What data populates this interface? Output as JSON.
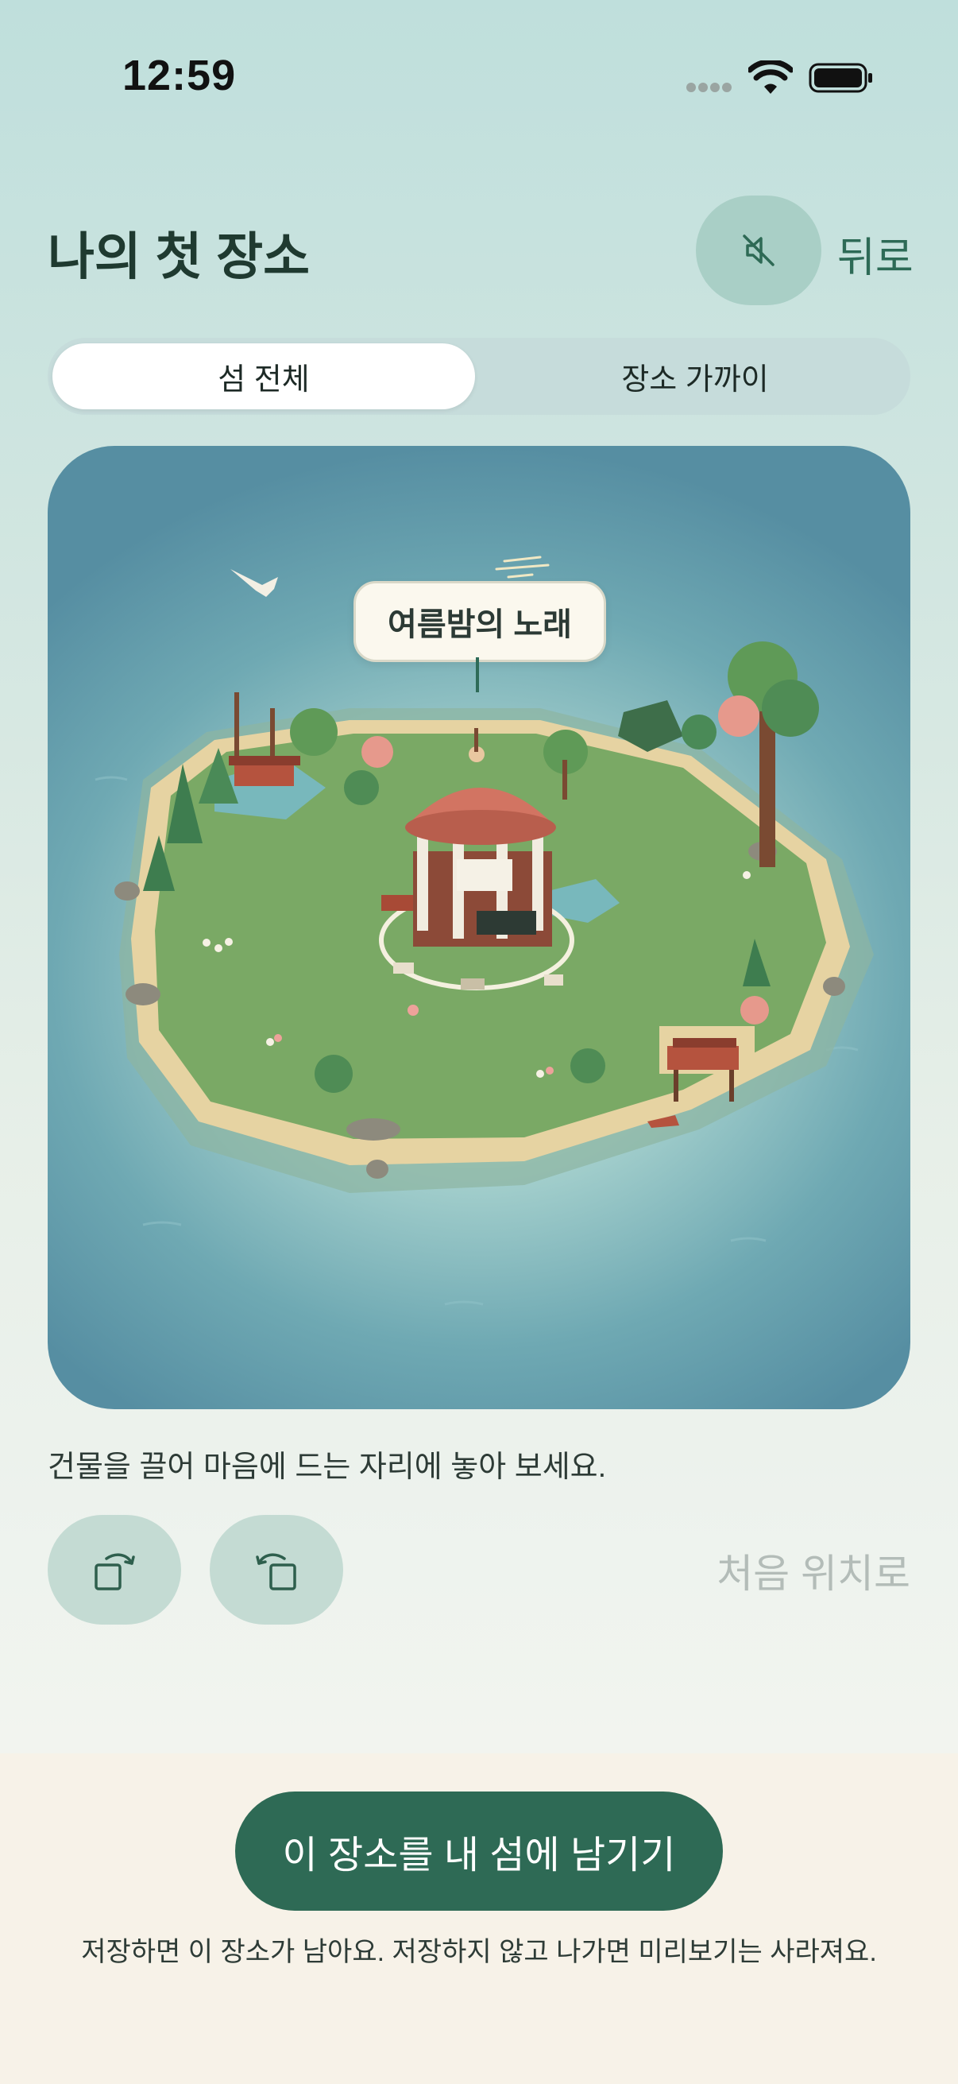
{
  "status_bar": {
    "time": "12:59",
    "icons": [
      "signal-dots-icon",
      "wifi-icon",
      "battery-icon"
    ]
  },
  "header": {
    "title": "나의 첫 장소",
    "mute_icon": "speaker-muted-icon",
    "back_label": "뒤로"
  },
  "segments": [
    {
      "label": "섬 전체",
      "selected": true
    },
    {
      "label": "장소 가까이",
      "selected": false
    }
  ],
  "scene": {
    "place_label": "여름밤의 노래"
  },
  "hint_text": "건물을 끌어 마음에 드는 자리에 놓아 보세요.",
  "controls": {
    "rotate_left_icon": "rotate-left-icon",
    "rotate_right_icon": "rotate-right-icon",
    "reset_label": "처음 위치로"
  },
  "bottom": {
    "save_label": "이 장소를 내 섬에 남기기",
    "note": "저장하면 이 장소가 남아요. 저장하지 않고 나가면 미리보기는 사라져요."
  },
  "colors": {
    "accent": "#2e6a55",
    "background_top": "#bfdfdc",
    "bottom_panel": "#f7f2e8",
    "ocean": "#568ea2",
    "grass": "#7aa965"
  }
}
